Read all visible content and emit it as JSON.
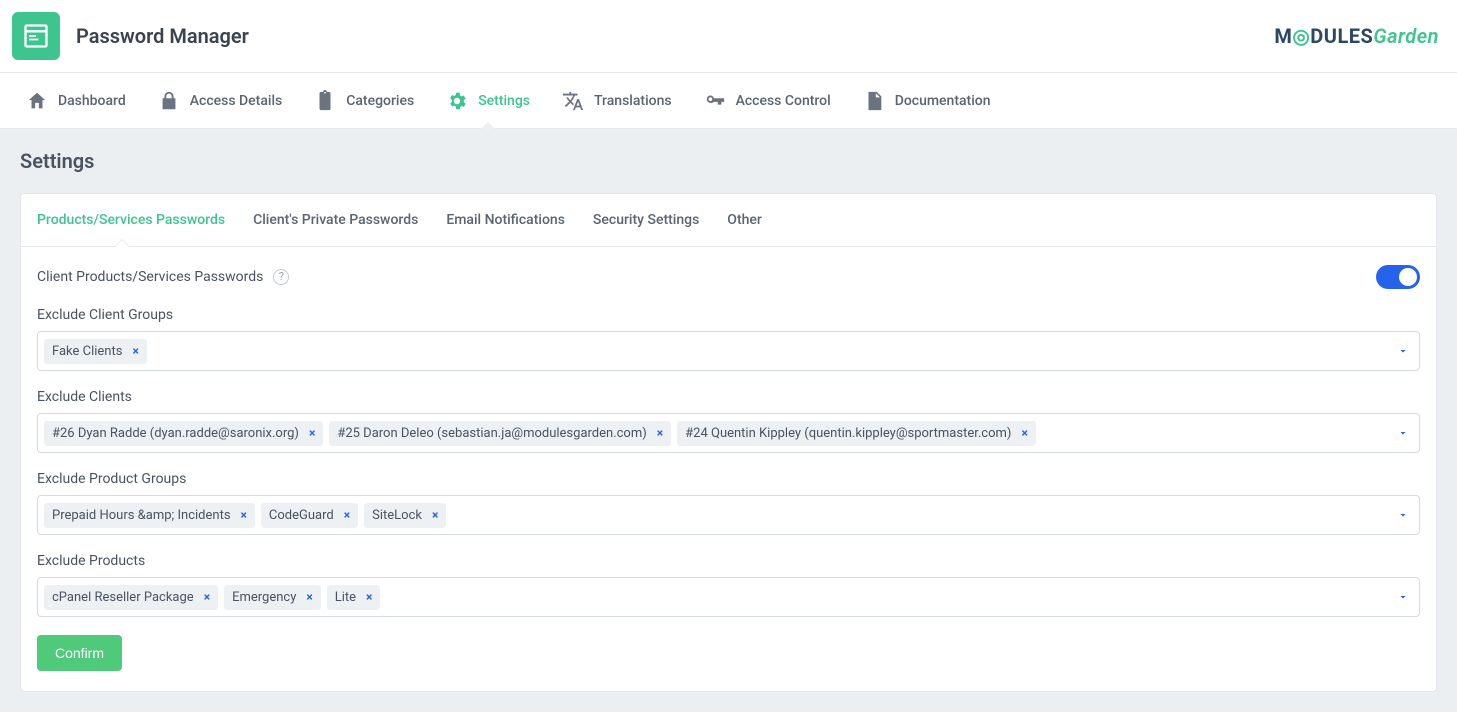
{
  "header": {
    "app_title": "Password Manager",
    "logo_main": "M",
    "logo_globe": "◎",
    "logo_rest": "DULES",
    "logo_accent": "Garden"
  },
  "nav": {
    "items": [
      {
        "label": "Dashboard",
        "icon": "home-icon"
      },
      {
        "label": "Access Details",
        "icon": "lock-icon"
      },
      {
        "label": "Categories",
        "icon": "clipboard-icon"
      },
      {
        "label": "Settings",
        "icon": "gear-icon",
        "active": true
      },
      {
        "label": "Translations",
        "icon": "translate-icon"
      },
      {
        "label": "Access Control",
        "icon": "key-icon"
      },
      {
        "label": "Documentation",
        "icon": "document-icon"
      }
    ]
  },
  "page": {
    "title": "Settings"
  },
  "tabs": [
    {
      "label": "Products/Services Passwords",
      "active": true
    },
    {
      "label": "Client's Private Passwords"
    },
    {
      "label": "Email Notifications"
    },
    {
      "label": "Security Settings"
    },
    {
      "label": "Other"
    }
  ],
  "settings": {
    "client_products_label": "Client Products/Services Passwords",
    "toggle_on": true,
    "fields": [
      {
        "label": "Exclude Client Groups",
        "chips": [
          "Fake Clients"
        ]
      },
      {
        "label": "Exclude Clients",
        "chips": [
          "#26 Dyan Radde (dyan.radde@saronix.org)",
          "#25 Daron Deleo (sebastian.ja@modulesgarden.com)",
          "#24 Quentin Kippley (quentin.kippley@sportmaster.com)"
        ]
      },
      {
        "label": "Exclude Product Groups",
        "chips": [
          "Prepaid Hours &amp; Incidents",
          "CodeGuard",
          "SiteLock"
        ]
      },
      {
        "label": "Exclude Products",
        "chips": [
          "cPanel Reseller Package",
          "Emergency",
          "Lite"
        ]
      }
    ],
    "confirm_label": "Confirm"
  }
}
